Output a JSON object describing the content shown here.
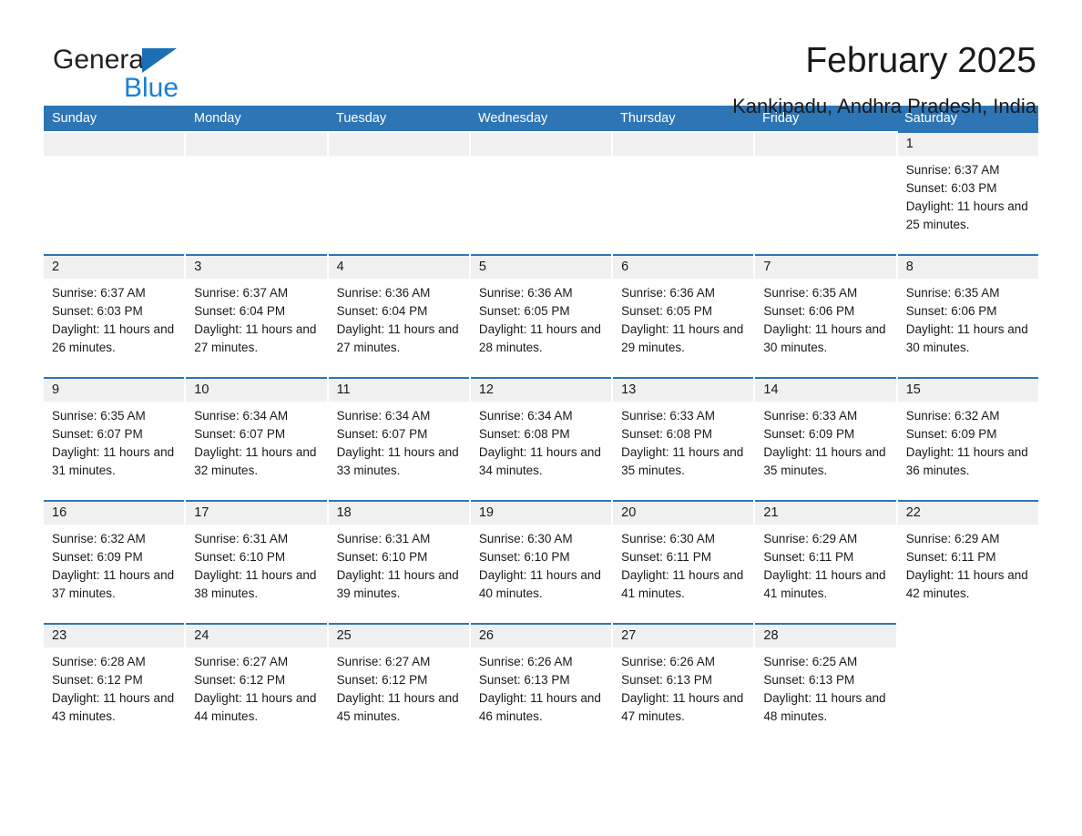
{
  "brand": {
    "word_general": "General",
    "word_blue": "Blue",
    "logo_icon": "triangle-logo-icon"
  },
  "header": {
    "title": "February 2025",
    "subtitle": "Kankipadu, Andhra Pradesh, India"
  },
  "colors": {
    "header_blue": "#2e75b6",
    "logo_blue": "#1a7fd4",
    "datebar_gray": "#f0f0f0",
    "text": "#1a1a1a"
  },
  "weekdays": [
    "Sunday",
    "Monday",
    "Tuesday",
    "Wednesday",
    "Thursday",
    "Friday",
    "Saturday"
  ],
  "weeks": [
    [
      {
        "day": "",
        "sunrise": "",
        "sunset": "",
        "daylight": ""
      },
      {
        "day": "",
        "sunrise": "",
        "sunset": "",
        "daylight": ""
      },
      {
        "day": "",
        "sunrise": "",
        "sunset": "",
        "daylight": ""
      },
      {
        "day": "",
        "sunrise": "",
        "sunset": "",
        "daylight": ""
      },
      {
        "day": "",
        "sunrise": "",
        "sunset": "",
        "daylight": ""
      },
      {
        "day": "",
        "sunrise": "",
        "sunset": "",
        "daylight": ""
      },
      {
        "day": "1",
        "sunrise": "Sunrise: 6:37 AM",
        "sunset": "Sunset: 6:03 PM",
        "daylight": "Daylight: 11 hours and 25 minutes."
      }
    ],
    [
      {
        "day": "2",
        "sunrise": "Sunrise: 6:37 AM",
        "sunset": "Sunset: 6:03 PM",
        "daylight": "Daylight: 11 hours and 26 minutes."
      },
      {
        "day": "3",
        "sunrise": "Sunrise: 6:37 AM",
        "sunset": "Sunset: 6:04 PM",
        "daylight": "Daylight: 11 hours and 27 minutes."
      },
      {
        "day": "4",
        "sunrise": "Sunrise: 6:36 AM",
        "sunset": "Sunset: 6:04 PM",
        "daylight": "Daylight: 11 hours and 27 minutes."
      },
      {
        "day": "5",
        "sunrise": "Sunrise: 6:36 AM",
        "sunset": "Sunset: 6:05 PM",
        "daylight": "Daylight: 11 hours and 28 minutes."
      },
      {
        "day": "6",
        "sunrise": "Sunrise: 6:36 AM",
        "sunset": "Sunset: 6:05 PM",
        "daylight": "Daylight: 11 hours and 29 minutes."
      },
      {
        "day": "7",
        "sunrise": "Sunrise: 6:35 AM",
        "sunset": "Sunset: 6:06 PM",
        "daylight": "Daylight: 11 hours and 30 minutes."
      },
      {
        "day": "8",
        "sunrise": "Sunrise: 6:35 AM",
        "sunset": "Sunset: 6:06 PM",
        "daylight": "Daylight: 11 hours and 30 minutes."
      }
    ],
    [
      {
        "day": "9",
        "sunrise": "Sunrise: 6:35 AM",
        "sunset": "Sunset: 6:07 PM",
        "daylight": "Daylight: 11 hours and 31 minutes."
      },
      {
        "day": "10",
        "sunrise": "Sunrise: 6:34 AM",
        "sunset": "Sunset: 6:07 PM",
        "daylight": "Daylight: 11 hours and 32 minutes."
      },
      {
        "day": "11",
        "sunrise": "Sunrise: 6:34 AM",
        "sunset": "Sunset: 6:07 PM",
        "daylight": "Daylight: 11 hours and 33 minutes."
      },
      {
        "day": "12",
        "sunrise": "Sunrise: 6:34 AM",
        "sunset": "Sunset: 6:08 PM",
        "daylight": "Daylight: 11 hours and 34 minutes."
      },
      {
        "day": "13",
        "sunrise": "Sunrise: 6:33 AM",
        "sunset": "Sunset: 6:08 PM",
        "daylight": "Daylight: 11 hours and 35 minutes."
      },
      {
        "day": "14",
        "sunrise": "Sunrise: 6:33 AM",
        "sunset": "Sunset: 6:09 PM",
        "daylight": "Daylight: 11 hours and 35 minutes."
      },
      {
        "day": "15",
        "sunrise": "Sunrise: 6:32 AM",
        "sunset": "Sunset: 6:09 PM",
        "daylight": "Daylight: 11 hours and 36 minutes."
      }
    ],
    [
      {
        "day": "16",
        "sunrise": "Sunrise: 6:32 AM",
        "sunset": "Sunset: 6:09 PM",
        "daylight": "Daylight: 11 hours and 37 minutes."
      },
      {
        "day": "17",
        "sunrise": "Sunrise: 6:31 AM",
        "sunset": "Sunset: 6:10 PM",
        "daylight": "Daylight: 11 hours and 38 minutes."
      },
      {
        "day": "18",
        "sunrise": "Sunrise: 6:31 AM",
        "sunset": "Sunset: 6:10 PM",
        "daylight": "Daylight: 11 hours and 39 minutes."
      },
      {
        "day": "19",
        "sunrise": "Sunrise: 6:30 AM",
        "sunset": "Sunset: 6:10 PM",
        "daylight": "Daylight: 11 hours and 40 minutes."
      },
      {
        "day": "20",
        "sunrise": "Sunrise: 6:30 AM",
        "sunset": "Sunset: 6:11 PM",
        "daylight": "Daylight: 11 hours and 41 minutes."
      },
      {
        "day": "21",
        "sunrise": "Sunrise: 6:29 AM",
        "sunset": "Sunset: 6:11 PM",
        "daylight": "Daylight: 11 hours and 41 minutes."
      },
      {
        "day": "22",
        "sunrise": "Sunrise: 6:29 AM",
        "sunset": "Sunset: 6:11 PM",
        "daylight": "Daylight: 11 hours and 42 minutes."
      }
    ],
    [
      {
        "day": "23",
        "sunrise": "Sunrise: 6:28 AM",
        "sunset": "Sunset: 6:12 PM",
        "daylight": "Daylight: 11 hours and 43 minutes."
      },
      {
        "day": "24",
        "sunrise": "Sunrise: 6:27 AM",
        "sunset": "Sunset: 6:12 PM",
        "daylight": "Daylight: 11 hours and 44 minutes."
      },
      {
        "day": "25",
        "sunrise": "Sunrise: 6:27 AM",
        "sunset": "Sunset: 6:12 PM",
        "daylight": "Daylight: 11 hours and 45 minutes."
      },
      {
        "day": "26",
        "sunrise": "Sunrise: 6:26 AM",
        "sunset": "Sunset: 6:13 PM",
        "daylight": "Daylight: 11 hours and 46 minutes."
      },
      {
        "day": "27",
        "sunrise": "Sunrise: 6:26 AM",
        "sunset": "Sunset: 6:13 PM",
        "daylight": "Daylight: 11 hours and 47 minutes."
      },
      {
        "day": "28",
        "sunrise": "Sunrise: 6:25 AM",
        "sunset": "Sunset: 6:13 PM",
        "daylight": "Daylight: 11 hours and 48 minutes."
      },
      {
        "day": "",
        "sunrise": "",
        "sunset": "",
        "daylight": ""
      }
    ]
  ]
}
